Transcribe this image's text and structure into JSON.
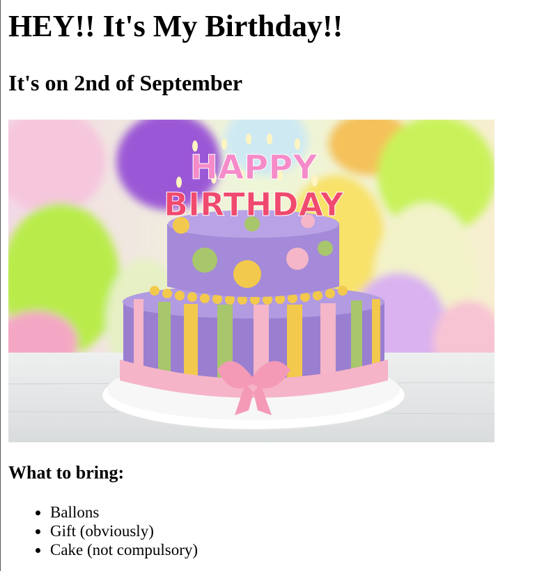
{
  "page": {
    "heading": "HEY!! It's My Birthday!!",
    "subheading": "It's on 2nd of September",
    "cake_image": {
      "icon": "birthday-cake-image",
      "topper_line1": "HAPPY",
      "topper_line2": "BIRTHDAY"
    },
    "bring_title": "What to bring:",
    "bring_items": [
      "Ballons",
      "Gift (obviously)",
      "Cake (not compulsory)"
    ]
  },
  "colors": {
    "text": "#000000",
    "background": "#ffffff",
    "cake_purple": "#9a7fd0",
    "cake_pink": "#f4b6c8",
    "cake_yellow": "#f2c94c",
    "cake_green": "#a8c66c",
    "balloon_purple": "#9b59d6",
    "balloon_lime": "#c9f25a",
    "balloon_yellow": "#f8e26a"
  }
}
